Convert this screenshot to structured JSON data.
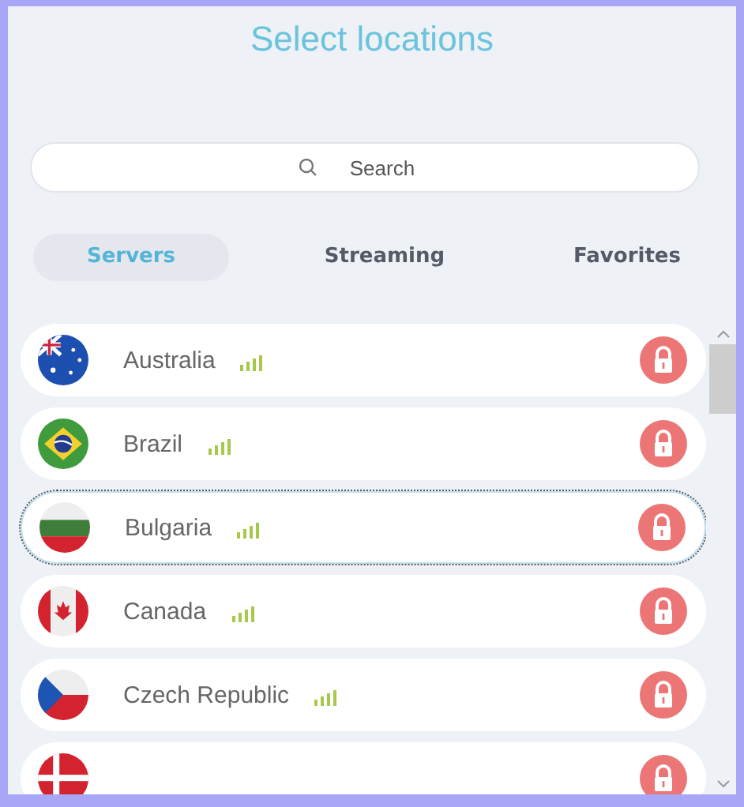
{
  "title": "Select locations",
  "search": {
    "placeholder": "Search"
  },
  "tabs": [
    {
      "label": "Servers",
      "selected": true
    },
    {
      "label": "Streaming",
      "selected": false
    },
    {
      "label": "Favorites",
      "selected": false
    }
  ],
  "locations": [
    {
      "name": "Australia",
      "kind": "australia",
      "selected": false,
      "locked": true
    },
    {
      "name": "Brazil",
      "kind": "brazil",
      "selected": false,
      "locked": true
    },
    {
      "name": "Bulgaria",
      "kind": "bulgaria",
      "selected": true,
      "locked": true
    },
    {
      "name": "Canada",
      "kind": "canada",
      "selected": false,
      "locked": true
    },
    {
      "name": "Czech Republic",
      "kind": "czech",
      "selected": false,
      "locked": true
    },
    {
      "kind": "denmark",
      "selected": false,
      "locked": true
    }
  ]
}
